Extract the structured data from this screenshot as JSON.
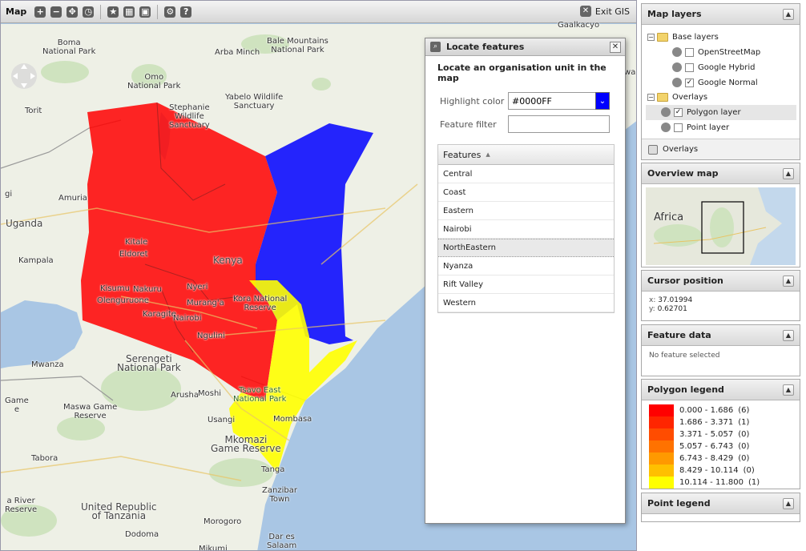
{
  "map": {
    "title": "Map",
    "exit_label": "Exit GIS",
    "toolbar_icons": [
      "zoom-in-icon",
      "zoom-out-icon",
      "zoom-extent-icon",
      "history-icon",
      "favorite-icon",
      "table-icon",
      "image-icon",
      "settings-icon",
      "help-icon"
    ],
    "places": {
      "boma": "Boma\nNational Park",
      "omo": "Omo\nNational Park",
      "bale": "Bale Mountains\nNational Park",
      "arba": "Arba Minch",
      "yabelo": "Yabelo Wildlife\nSanctuary",
      "stephanie": "Stephanie\nWildlife\nSanctuary",
      "torit": "Torit",
      "gulu": "gi",
      "amuria": "Amuria",
      "uganda": "Uganda",
      "kampala": "Kampala",
      "kitale": "Kitale",
      "eldoret": "Eldoret",
      "kisumu": "Kisumu",
      "nakuru": "Nakuru",
      "nyeri": "Nyeri",
      "murang": "Murang'a",
      "kenya": "Kenya",
      "kora": "Kora National\nReserve",
      "olengu": "Olenguruone",
      "karagite": "Karagite",
      "nairobi": "Nairobi",
      "ngulini": "Ngulini",
      "tanaj": "Tana",
      "serengeti": "Serengeti\nNational Park",
      "mwanza": "Mwanza",
      "arusha": "Arusha",
      "moshi": "Moshi",
      "tsavo": "Tsavo East\nNational Park",
      "maswa": "Maswa Game\nReserve",
      "game": "Game\ne",
      "usangi": "Usangi",
      "mombasa": "Mombasa",
      "mkomazi": "Mkomazi\nGame Reserve",
      "tabora": "Tabora",
      "tanga": "Tanga",
      "zanzibar": "Zanzibar\nTown",
      "ruaha": "a River\nReserve",
      "tanzania": "United Republic\nof Tanzania",
      "morogoro": "Morogoro",
      "dodoma": "Dodoma",
      "dares": "Dar es\nSalaam",
      "mikumi": "Mikumi",
      "galkacyo": "Gaalkacyo",
      "rowa": "rowa"
    }
  },
  "locate": {
    "title": "Locate features",
    "subtitle": "Locate an organisation unit in the map",
    "highlight_label": "Highlight color",
    "highlight_value": "#0000FF",
    "highlight_color": "#0000ff",
    "filter_label": "Feature filter",
    "filter_value": "",
    "features_header": "Features",
    "features": [
      "Central",
      "Coast",
      "Eastern",
      "Nairobi",
      "NorthEastern",
      "Nyanza",
      "Rift Valley",
      "Western"
    ],
    "selected": "NorthEastern"
  },
  "layers_panel": {
    "title": "Map layers",
    "base_layers_label": "Base layers",
    "base_layers": [
      {
        "label": "OpenStreetMap",
        "checked": false
      },
      {
        "label": "Google Hybrid",
        "checked": false
      },
      {
        "label": "Google Normal",
        "checked": true
      }
    ],
    "overlays_label": "Overlays",
    "overlays": [
      {
        "label": "Polygon layer",
        "checked": true
      },
      {
        "label": "Point layer",
        "checked": false
      }
    ],
    "footer_label": "Overlays"
  },
  "overview_panel": {
    "title": "Overview map",
    "label": "Africa"
  },
  "cursor_panel": {
    "title": "Cursor position",
    "x_label": "x:",
    "x_value": "37.01994",
    "y_label": "y:",
    "y_value": "0.62701"
  },
  "feature_panel": {
    "title": "Feature data",
    "empty_text": "No feature selected"
  },
  "polygon_legend": {
    "title": "Polygon legend",
    "items": [
      {
        "range": "0.000 - 1.686",
        "count": "(6)",
        "color": "#ff0000"
      },
      {
        "range": "1.686 - 3.371",
        "count": "(1)",
        "color": "#ff2500"
      },
      {
        "range": "3.371 - 5.057",
        "count": "(0)",
        "color": "#ff4c00"
      },
      {
        "range": "5.057 - 6.743",
        "count": "(0)",
        "color": "#ff7200"
      },
      {
        "range": "6.743 - 8.429",
        "count": "(0)",
        "color": "#ff9900"
      },
      {
        "range": "8.429 - 10.114",
        "count": "(0)",
        "color": "#ffc000"
      },
      {
        "range": "10.114 - 11.800",
        "count": "(1)",
        "color": "#ffff00"
      }
    ]
  },
  "point_legend": {
    "title": "Point legend"
  }
}
